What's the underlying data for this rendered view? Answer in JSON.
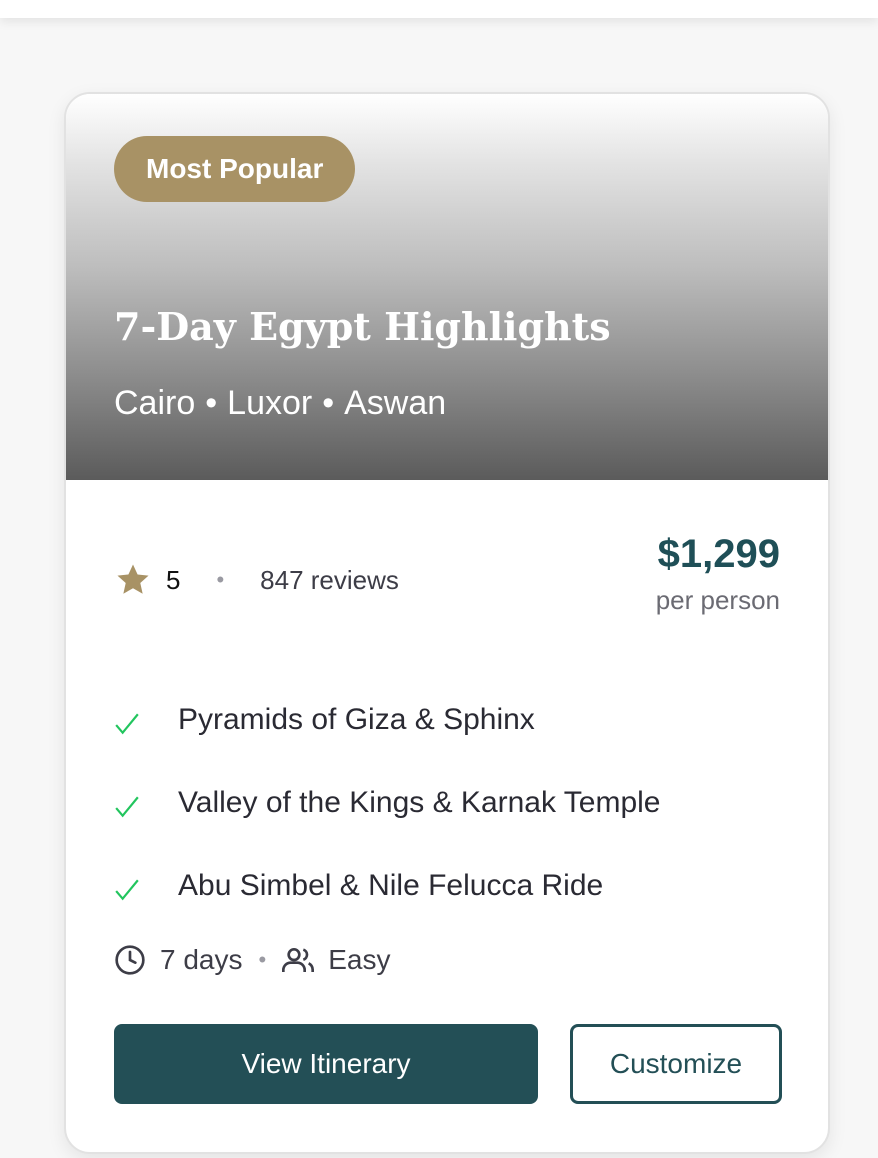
{
  "badge": {
    "label": "Most Popular"
  },
  "tour": {
    "title": "7-Day Egypt Highlights",
    "cities": [
      "Cairo",
      "Luxor",
      "Aswan"
    ],
    "city_separator": "•"
  },
  "rating": {
    "value": "5",
    "separator": "•",
    "reviews": "847 reviews",
    "star_color": "#a89265"
  },
  "price": {
    "amount": "$1,299",
    "unit": "per person",
    "color": "#1f4f57"
  },
  "features": [
    {
      "text": "Pyramids of Giza & Sphinx",
      "icon": "check-icon"
    },
    {
      "text": "Valley of the Kings & Karnak Temple",
      "icon": "check-icon"
    },
    {
      "text": "Abu Simbel & Nile Felucca Ride",
      "icon": "check-icon"
    }
  ],
  "meta": {
    "duration": "7 days",
    "separator": "•",
    "difficulty": "Easy",
    "duration_icon": "clock-icon",
    "difficulty_icon": "users-icon"
  },
  "actions": {
    "primary_label": "View Itinerary",
    "secondary_label": "Customize",
    "brand_color": "#234f56"
  },
  "colors": {
    "badge_bg": "#a89265",
    "check_color": "#22c55e"
  }
}
